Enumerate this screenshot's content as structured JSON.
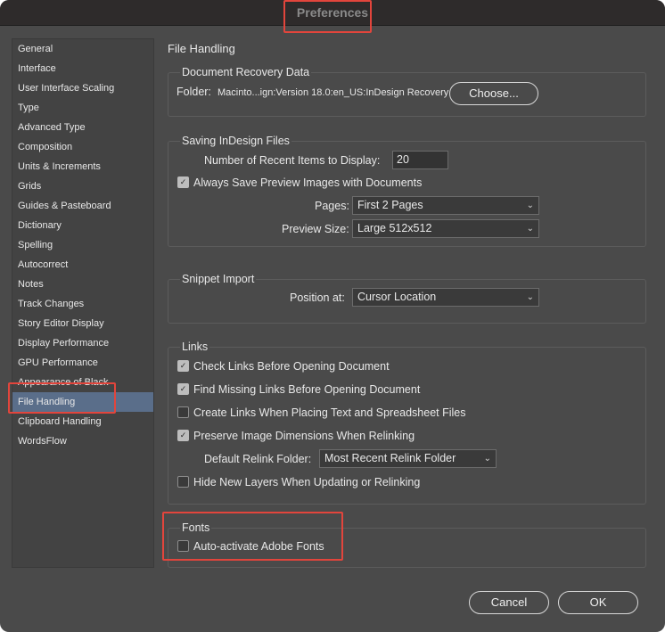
{
  "window": {
    "title": "Preferences"
  },
  "sidebar": {
    "items": [
      {
        "label": "General"
      },
      {
        "label": "Interface"
      },
      {
        "label": "User Interface Scaling"
      },
      {
        "label": "Type"
      },
      {
        "label": "Advanced Type"
      },
      {
        "label": "Composition"
      },
      {
        "label": "Units & Increments"
      },
      {
        "label": "Grids"
      },
      {
        "label": "Guides & Pasteboard"
      },
      {
        "label": "Dictionary"
      },
      {
        "label": "Spelling"
      },
      {
        "label": "Autocorrect"
      },
      {
        "label": "Notes"
      },
      {
        "label": "Track Changes"
      },
      {
        "label": "Story Editor Display"
      },
      {
        "label": "Display Performance"
      },
      {
        "label": "GPU Performance"
      },
      {
        "label": "Appearance of Black"
      },
      {
        "label": "File Handling",
        "selected": true
      },
      {
        "label": "Clipboard Handling"
      },
      {
        "label": "WordsFlow"
      }
    ]
  },
  "pane": {
    "title": "File Handling"
  },
  "recovery": {
    "title": "Document Recovery Data",
    "folder_label": "Folder:",
    "folder_path": "Macinto...ign:Version 18.0:en_US:InDesign Recovery",
    "choose_label": "Choose..."
  },
  "saving": {
    "title": "Saving InDesign Files",
    "recent_label": "Number of Recent Items to Display:",
    "recent_value": "20",
    "preview_label": "Always Save Preview Images with Documents",
    "preview_checked": true,
    "pages_label": "Pages:",
    "pages_value": "First 2 Pages",
    "size_label": "Preview Size:",
    "size_value": "Large 512x512"
  },
  "snippet": {
    "title": "Snippet Import",
    "position_label": "Position at:",
    "position_value": "Cursor Location"
  },
  "links": {
    "title": "Links",
    "check_links": {
      "label": "Check Links Before Opening Document",
      "checked": true
    },
    "find_missing": {
      "label": "Find Missing Links Before Opening Document",
      "checked": true
    },
    "create_links": {
      "label": "Create Links When Placing Text and Spreadsheet Files",
      "checked": false
    },
    "preserve_dims": {
      "label": "Preserve Image Dimensions When Relinking",
      "checked": true
    },
    "relink_label": "Default Relink Folder:",
    "relink_value": "Most Recent Relink Folder",
    "hide_layers": {
      "label": "Hide New Layers When Updating or Relinking",
      "checked": false
    }
  },
  "fonts": {
    "title": "Fonts",
    "auto_activate": {
      "label": "Auto-activate Adobe Fonts",
      "checked": false
    }
  },
  "footer": {
    "cancel_label": "Cancel",
    "ok_label": "OK"
  },
  "icons": {
    "check": "checkmark-icon",
    "chevron": "chevron-down-icon"
  },
  "colors": {
    "window_bg": "#4a4a4a",
    "selection": "#5a6e8a",
    "highlight_box": "#e2453c"
  }
}
